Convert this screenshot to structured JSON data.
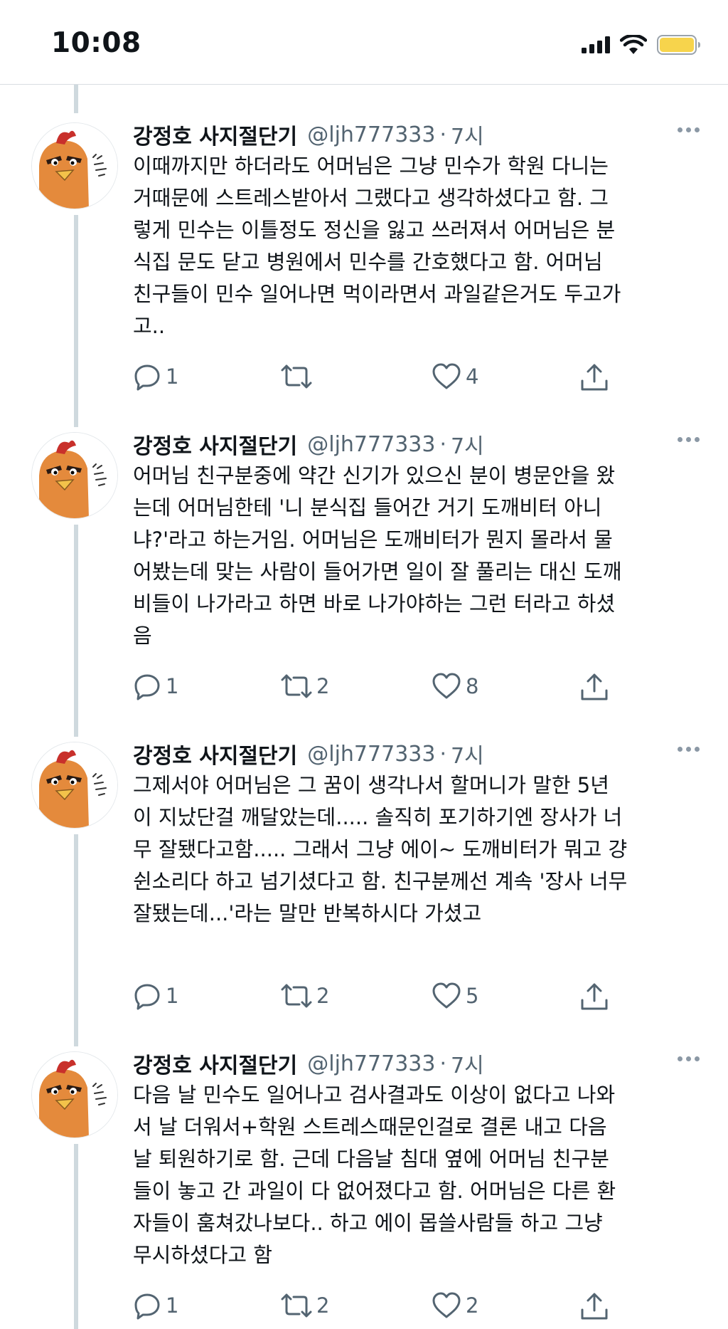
{
  "status_bar": {
    "time": "10:08",
    "icons": [
      "signal-icon",
      "wifi-icon",
      "battery-icon"
    ],
    "battery_color": "#f7d44c"
  },
  "colors": {
    "text": "#0f1419",
    "secondary": "#536471",
    "thread_line": "#cfd9de",
    "avatar_bg": "#e48a3c"
  },
  "tweets": [
    {
      "author": "강정호 사지절단기",
      "handle": "@ljh777333",
      "time": "7시",
      "lines": [
        "이때까지만 하더라도 어머님은 그냥 민수가 학원 다니는",
        "거때문에 스트레스받아서 그랬다고 생각하셨다고 함. 그",
        "렇게 민수는 이틀정도 정신을 잃고 쓰러져서 어머님은 분",
        "식집 문도 닫고 병원에서 민수를 간호했다고 함. 어머님",
        "친구들이 민수 일어나면 먹이라면서 과일같은거도 두고가",
        "고.."
      ],
      "replies": "1",
      "retweets": "",
      "likes": "4"
    },
    {
      "author": "강정호 사지절단기",
      "handle": "@ljh777333",
      "time": "7시",
      "lines": [
        "어머님 친구분중에 약간 신기가 있으신 분이 병문안을 왔",
        "는데 어머님한테 '니 분식집 들어간 거기 도깨비터 아니",
        "냐?'라고 하는거임. 어머님은 도깨비터가 뭔지 몰라서 물",
        "어봤는데 맞는 사람이 들어가면 일이 잘 풀리는 대신 도깨",
        "비들이 나가라고 하면 바로 나가야하는 그런 터라고 하셨",
        "음"
      ],
      "replies": "1",
      "retweets": "2",
      "likes": "8"
    },
    {
      "author": "강정호 사지절단기",
      "handle": "@ljh777333",
      "time": "7시",
      "lines": [
        "그제서야 어머님은 그 꿈이 생각나서 할머니가 말한 5년",
        "이 지났단걸 깨달았는데..... 솔직히 포기하기엔 장사가 너",
        "무 잘됐다고함..... 그래서 그냥 에이~ 도깨비터가 뭐고 걍",
        "쉰소리다 하고 넘기셨다고 함. 친구분께선 계속 '장사 너무",
        "잘됐는데...'라는 말만 반복하시다 가셨고"
      ],
      "replies": "1",
      "retweets": "2",
      "likes": "5"
    },
    {
      "author": "강정호 사지절단기",
      "handle": "@ljh777333",
      "time": "7시",
      "lines": [
        "다음 날 민수도 일어나고 검사결과도 이상이 없다고 나와",
        "서 날 더워서+학원 스트레스때문인걸로 결론 내고 다음",
        "날 퇴원하기로 함. 근데 다음날 침대 옆에 어머님 친구분",
        "들이 놓고 간 과일이 다 없어졌다고 함. 어머님은 다른 환",
        "자들이 훔쳐갔나보다.. 하고 에이 몹쓸사람들 하고 그냥",
        "무시하셨다고 함"
      ],
      "replies": "1",
      "retweets": "2",
      "likes": "2"
    }
  ],
  "action_icons": [
    "reply-icon",
    "retweet-icon",
    "like-icon",
    "share-icon"
  ]
}
